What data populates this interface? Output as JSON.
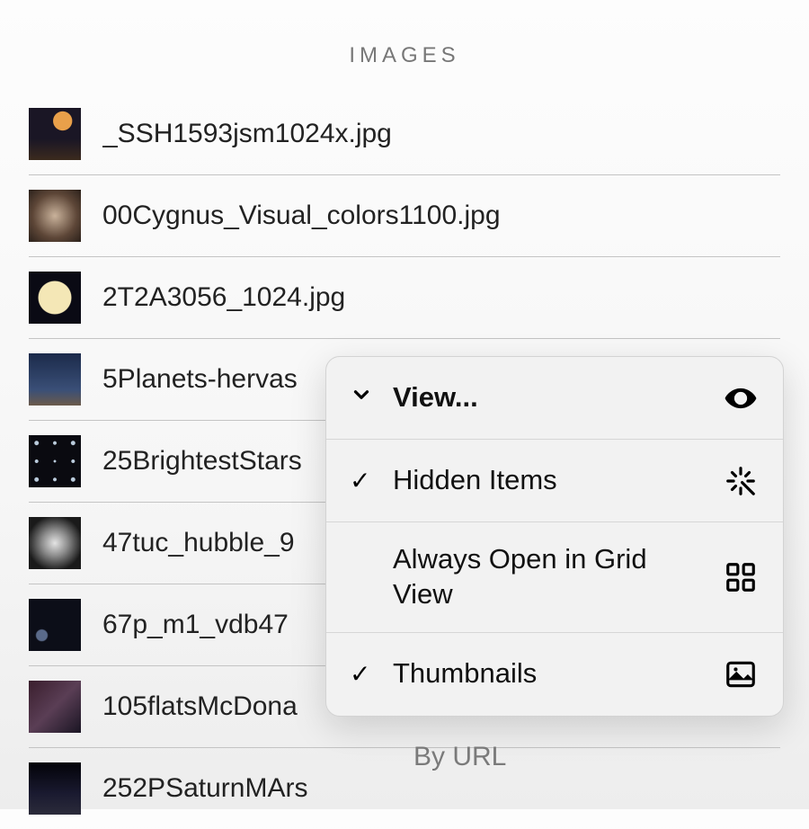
{
  "section_header": "IMAGES",
  "files": [
    {
      "name": "_SSH1593jsm1024x.jpg"
    },
    {
      "name": "00Cygnus_Visual_colors1100.jpg"
    },
    {
      "name": "2T2A3056_1024.jpg"
    },
    {
      "name": "5Planets-hervas"
    },
    {
      "name": "25BrightestStars"
    },
    {
      "name": "47tuc_hubble_9"
    },
    {
      "name": "67p_m1_vdb47"
    },
    {
      "name": "105flatsMcDona"
    },
    {
      "name": "252PSaturnMArs"
    }
  ],
  "menu": {
    "header": {
      "label": "View...",
      "expanded": true
    },
    "items": [
      {
        "label": "Hidden Items",
        "checked": true,
        "icon": "sparkle-cursor-icon"
      },
      {
        "label": "Always Open in Grid View",
        "checked": false,
        "icon": "grid-icon"
      },
      {
        "label": "Thumbnails",
        "checked": true,
        "icon": "picture-icon"
      }
    ]
  },
  "footer_label": "By URL"
}
